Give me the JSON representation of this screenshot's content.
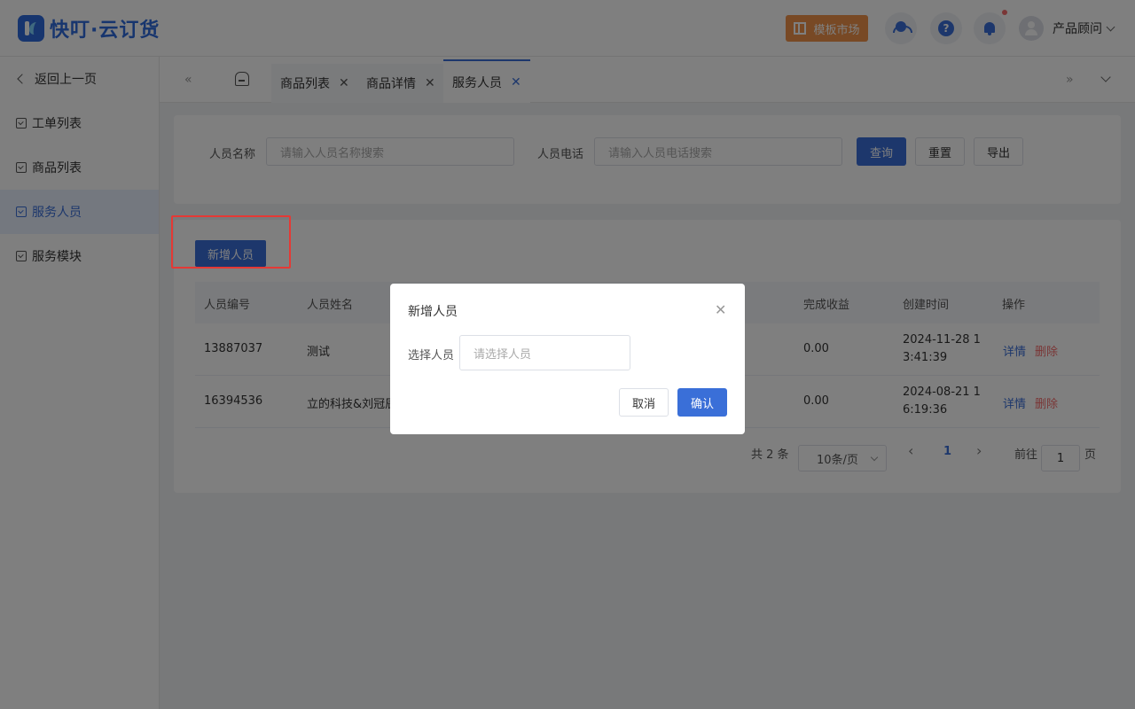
{
  "app": {
    "logo_text": "快叮·云订货"
  },
  "header": {
    "market_label": "模板市场",
    "help_glyph": "?",
    "user_name": "产品顾问",
    "accent_color": "#3a6fd8",
    "market_color": "#f0934a"
  },
  "sidebar": {
    "back_label": "返回上一页",
    "items": [
      {
        "label": "工单列表"
      },
      {
        "label": "商品列表"
      },
      {
        "label": "服务人员",
        "active": true
      },
      {
        "label": "服务模块"
      }
    ]
  },
  "tabs": {
    "prev_glyph": "«",
    "next_glyph": "»",
    "items": [
      {
        "label": "商品列表"
      },
      {
        "label": "商品详情"
      },
      {
        "label": "服务人员",
        "active": true
      }
    ],
    "close_glyph": "✕"
  },
  "search": {
    "name_label": "人员名称",
    "name_placeholder": "请输入人员名称搜索",
    "phone_label": "人员电话",
    "phone_placeholder": "请输入人员电话搜索",
    "query_label": "查询",
    "reset_label": "重置",
    "export_label": "导出"
  },
  "toolbar": {
    "add_label": "新增人员"
  },
  "table": {
    "headers": {
      "id": "人员编号",
      "name": "人员姓名",
      "income": "完成收益",
      "created": "创建时间",
      "ops": "操作"
    },
    "rows": [
      {
        "id": "13887037",
        "name": "测试",
        "income": "0.00",
        "created": "2024-11-28 13:41:39",
        "detail": "详情",
        "delete": "删除"
      },
      {
        "id": "16394536",
        "name": "立的科技&刘冠辰",
        "income": "0.00",
        "created": "2024-08-21 16:19:36",
        "detail": "详情",
        "delete": "删除"
      }
    ]
  },
  "pagination": {
    "total_text": "共 2 条",
    "page_size": "10条/页",
    "prev_glyph": "‹",
    "current_page": "1",
    "next_glyph": "›",
    "goto_label": "前往",
    "goto_value": "1",
    "page_unit": "页"
  },
  "modal": {
    "title": "新增人员",
    "close_glyph": "✕",
    "field_label": "选择人员",
    "field_placeholder": "请选择人员",
    "cancel_label": "取消",
    "confirm_label": "确认"
  }
}
